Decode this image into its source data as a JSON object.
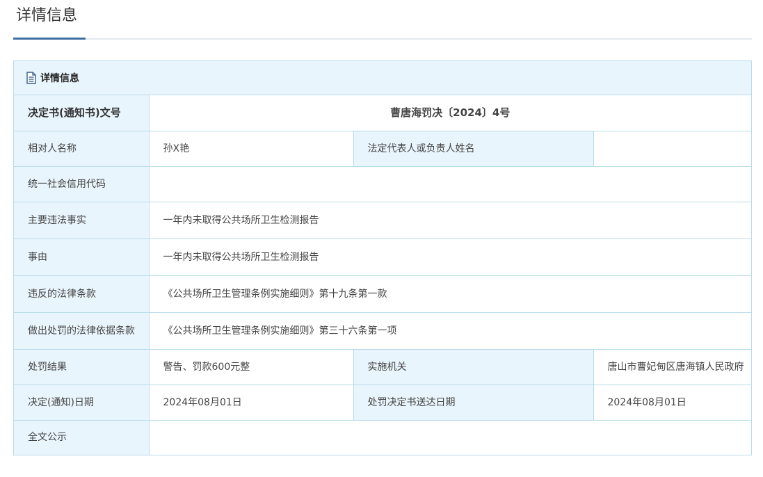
{
  "page": {
    "title": "详情信息"
  },
  "panel": {
    "title": "详情信息",
    "icon": "document-icon"
  },
  "details": {
    "doc_number": {
      "label": "决定书(通知书)文号",
      "value": "曹唐海罚决〔2024〕4号"
    },
    "party_name": {
      "label": "相对人名称",
      "value": "孙X艳"
    },
    "legal_rep": {
      "label": "法定代表人或负责人姓名",
      "value": ""
    },
    "credit_code": {
      "label": "统一社会信用代码",
      "value": ""
    },
    "main_facts": {
      "label": "主要违法事实",
      "value": "一年内未取得公共场所卫生检测报告"
    },
    "cause": {
      "label": "事由",
      "value": "一年内未取得公共场所卫生检测报告"
    },
    "violated_law": {
      "label": "违反的法律条款",
      "value": "《公共场所卫生管理条例实施细则》第十九条第一款"
    },
    "penalty_basis": {
      "label": "做出处罚的法律依据条款",
      "value": "《公共场所卫生管理条例实施细则》第三十六条第一项"
    },
    "penalty_result": {
      "label": "处罚结果",
      "value": "警告、罚款600元整"
    },
    "authority": {
      "label": "实施机关",
      "value": "唐山市曹妃甸区唐海镇人民政府"
    },
    "decision_date": {
      "label": "决定(通知)日期",
      "value": "2024年08月01日"
    },
    "delivery_date": {
      "label": "处罚决定书送达日期",
      "value": "2024年08月01日"
    },
    "full_text": {
      "label": "全文公示",
      "value": ""
    }
  },
  "colors": {
    "accent": "#3d6fa3",
    "label_bg": "#e9f5fc",
    "border": "#b9dcea"
  }
}
